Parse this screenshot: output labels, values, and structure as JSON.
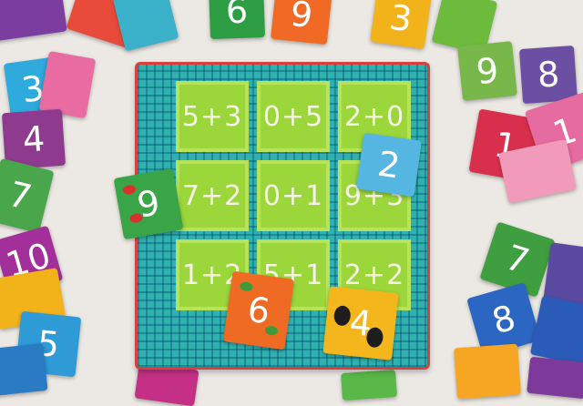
{
  "board": {
    "cells": [
      "5+3",
      "0+5",
      "2+0",
      "7+2",
      "0+1",
      "9+3",
      "1+2",
      "5+1",
      "2+2"
    ]
  },
  "cards": [
    {
      "name": "card-9-ladybird",
      "digit": "9",
      "color": "#3aa547"
    },
    {
      "name": "card-2-crocodile",
      "digit": "2",
      "color": "#56b6e2"
    },
    {
      "name": "card-6-turtle",
      "digit": "6",
      "color": "#ef6a23"
    },
    {
      "name": "card-4-toucan",
      "digit": "4",
      "color": "#f3b71d"
    },
    {
      "name": "card-9-scattered",
      "digit": "9",
      "color": "#78b84a"
    },
    {
      "name": "card-8-penguin",
      "digit": "8",
      "color": "#6a4fa3"
    },
    {
      "name": "card-1-dolphin",
      "digit": "1",
      "color": "#d8304c"
    },
    {
      "name": "card-3-giraffe",
      "digit": "3",
      "color": "#2eaadc"
    },
    {
      "name": "card-4-left",
      "digit": "4",
      "color": "#8d3a8f"
    },
    {
      "name": "card-7-left",
      "digit": "7",
      "color": "#4aa64a"
    },
    {
      "name": "card-5-left",
      "digit": "5",
      "color": "#2e9bd6"
    },
    {
      "name": "card-7-right",
      "digit": "7",
      "color": "#3f9e3f"
    },
    {
      "name": "card-8-right",
      "digit": "8",
      "color": "#2b66c2"
    },
    {
      "name": "card-6-top",
      "digit": "6",
      "color": "#2e9e45"
    },
    {
      "name": "card-9-top",
      "digit": "9",
      "color": "#f06a25"
    },
    {
      "name": "card-10-left",
      "digit": "10",
      "color": "#a3309a"
    },
    {
      "name": "card-1-right",
      "digit": "1",
      "color": "#e66ba0"
    },
    {
      "name": "card-3-top",
      "digit": "3",
      "color": "#f2b21a"
    }
  ]
}
